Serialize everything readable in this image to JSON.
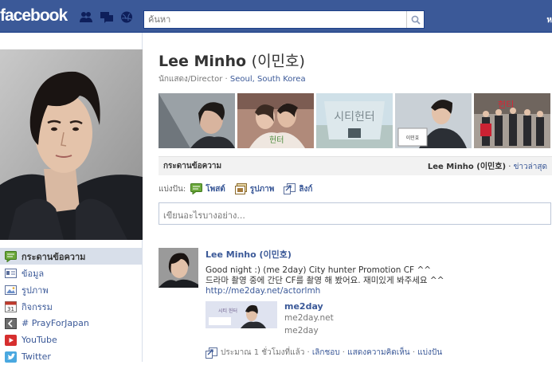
{
  "header": {
    "logo": "facebook",
    "search_placeholder": "ค้นหา",
    "top_right": "ห"
  },
  "colors": {
    "brand": "#3b5998",
    "link": "#3b5998",
    "nav_active": "#d8dfea"
  },
  "sidebar": {
    "items": [
      {
        "label": "กระดานข้อความ",
        "icon": "wall-icon",
        "active": true
      },
      {
        "label": "ข้อมูล",
        "icon": "info-icon",
        "active": false
      },
      {
        "label": "รูปภาพ",
        "icon": "photos-icon",
        "active": false
      },
      {
        "label": "กิจกรรม",
        "icon": "calendar-icon",
        "active": false
      },
      {
        "label": "# PrayForJapan",
        "icon": "app-icon",
        "active": false
      },
      {
        "label": "YouTube",
        "icon": "youtube-icon",
        "active": false
      },
      {
        "label": "Twitter",
        "icon": "twitter-icon",
        "active": false
      }
    ]
  },
  "profile": {
    "name": "Lee Minho",
    "name_korean": "(이민호)",
    "occupation": "นักแสดง/Director",
    "location": "Seoul, South Korea"
  },
  "wall": {
    "title": "กระดานข้อความ",
    "filter_name": "Lee Minho (이민호)",
    "filter_link": "ข่าวล่าสุด",
    "share_label": "แบ่งปัน:",
    "share_options": [
      "โพสต์",
      "รูปภาพ",
      "ลิงก์"
    ],
    "composer_placeholder": "เขียนอะไรบางอย่าง..."
  },
  "post": {
    "author": "Lee Minho (이민호)",
    "line1": "Good night :) (me 2day) City hunter Promotion CF ^^",
    "line2": "드라마 촬영 중에 간단 CF를 촬영 해 봤어요. 재미있게 봐주세요 ^^",
    "link": "http://me2day.net/actorlmh",
    "attachment": {
      "title": "me2day",
      "domain": "me2day.net",
      "desc": "me2day"
    },
    "time": "ประมาณ 1 ชั่วโมงที่แล้ว",
    "actions": [
      "เลิกชอบ",
      "แสดงความคิดเห็น",
      "แบ่งปัน"
    ]
  }
}
